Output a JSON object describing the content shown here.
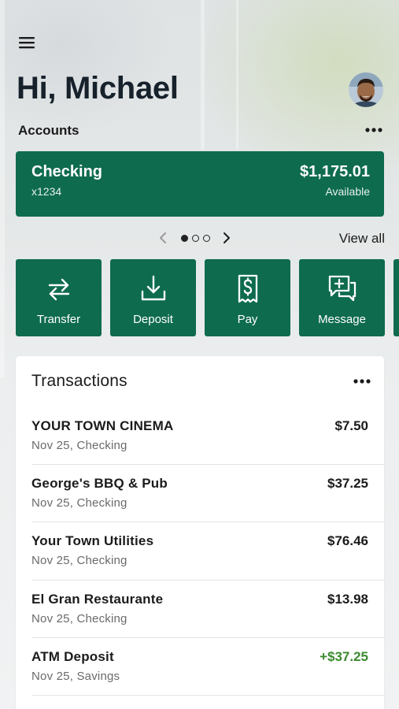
{
  "header": {
    "greeting": "Hi, Michael"
  },
  "accounts": {
    "label": "Accounts",
    "card": {
      "name": "Checking",
      "number": "x1234",
      "balance": "$1,175.01",
      "balance_label": "Available"
    },
    "pager": {
      "pages": 3,
      "current": 1
    },
    "view_all": "View all"
  },
  "actions": [
    {
      "label": "Transfer",
      "icon": "transfer-arrows-icon"
    },
    {
      "label": "Deposit",
      "icon": "deposit-tray-icon"
    },
    {
      "label": "Pay",
      "icon": "pay-receipt-icon"
    },
    {
      "label": "Message",
      "icon": "message-plus-icon"
    }
  ],
  "transactions": {
    "title": "Transactions",
    "items": [
      {
        "merchant": "YOUR TOWN CINEMA",
        "meta": "Nov 25, Checking",
        "amount": "$7.50"
      },
      {
        "merchant": "George's BBQ & Pub",
        "meta": "Nov 25, Checking",
        "amount": "$37.25"
      },
      {
        "merchant": "Your Town Utilities",
        "meta": "Nov 25, Checking",
        "amount": "$76.46"
      },
      {
        "merchant": "El Gran Restaurante",
        "meta": "Nov 25, Checking",
        "amount": "$13.98"
      },
      {
        "merchant": "ATM Deposit",
        "meta": "Nov 25, Savings",
        "amount": "+$37.25"
      }
    ]
  },
  "colors": {
    "brand_green": "#0e6b4e",
    "credit_green": "#3b8a2e"
  }
}
